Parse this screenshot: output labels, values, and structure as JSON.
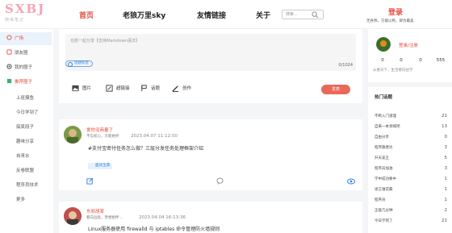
{
  "header": {
    "logo_text": "SXBJ",
    "logo_sub": "随缘笔记",
    "nav": [
      "首页",
      "老狼万里sky",
      "友情链接",
      "关于"
    ],
    "search_placeholder": "搜索...",
    "login": "登录",
    "motto": "无各称，方能以称，即为最美"
  },
  "sidebar": {
    "items": [
      "广场",
      "朋友圈",
      "我的圈子",
      "推荐圈子",
      "上班摸鱼",
      "今日学到了",
      "搞笑段子",
      "趣味分享",
      "自来水",
      "反卷联盟",
      "程序员技术",
      "更多"
    ]
  },
  "composer": {
    "placeholder": "也想一起分享【支持Markdown语法】",
    "topic_label": "话题标签",
    "char_count": "0/1024",
    "tools": [
      "图片",
      "超链接",
      "话题",
      "创作"
    ],
    "publish": "发表"
  },
  "posts": [
    {
      "name": "爱你没商量了",
      "sub": "不忘初心，方能始终",
      "time": "2023.04.07 11:12:50",
      "body": "#支付宝密付任务怎么做？三层分发任务处理框架介绍",
      "tag": "面试宝典"
    },
    {
      "name": "东邪胡某",
      "sub": "看向远处，梦想相伴...",
      "time": "2023.04.04 16:13:36",
      "body": "Linux服务器使用 firewalld 与 iptables 命令管理防火墙规则"
    }
  ],
  "profile": {
    "login_label": "登录/注册",
    "motto": "从者天下，生活者向往学",
    "stats": [
      "0",
      "0",
      "0",
      "555"
    ]
  },
  "hot": {
    "title": "热门话题",
    "items": [
      {
        "label": "不断入门道理",
        "count": "21"
      },
      {
        "label": "自来一本领域吧",
        "count": "13"
      },
      {
        "label": "自由分享",
        "count": "0"
      },
      {
        "label": "程序猿者达",
        "count": "3"
      },
      {
        "label": "升天美王",
        "count": "5"
      },
      {
        "label": "程序员加油",
        "count": "3"
      },
      {
        "label": "学中成功要中",
        "count": "1"
      },
      {
        "label": "语言谁花最",
        "count": "1"
      },
      {
        "label": "程序员",
        "count": "1"
      },
      {
        "label": "正能几分钟",
        "count": "2"
      },
      {
        "label": "今日学到了",
        "count": "21"
      }
    ]
  },
  "colors": {
    "accent": "#e64a3b",
    "link": "#2c7be5",
    "publish": "#e8695a"
  }
}
